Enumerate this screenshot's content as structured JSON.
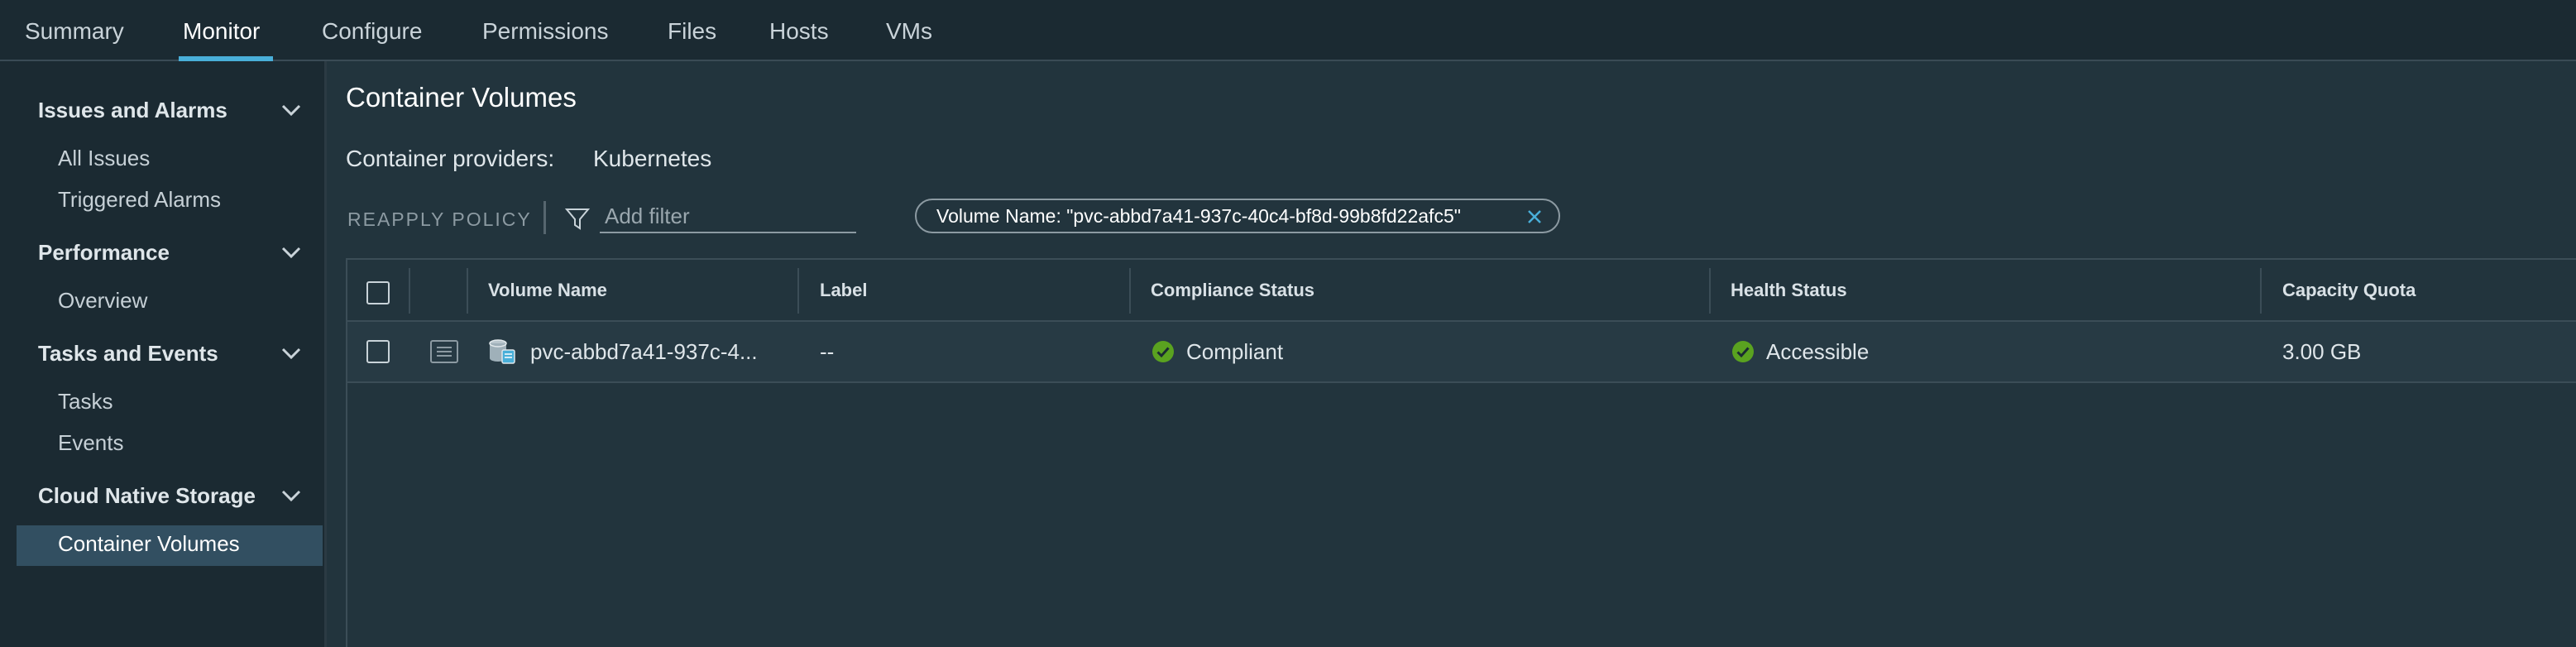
{
  "tabs": [
    {
      "label": "Summary"
    },
    {
      "label": "Monitor"
    },
    {
      "label": "Configure"
    },
    {
      "label": "Permissions"
    },
    {
      "label": "Files"
    },
    {
      "label": "Hosts"
    },
    {
      "label": "VMs"
    }
  ],
  "active_tab": "Monitor",
  "sidebar": {
    "groups": [
      {
        "label": "Issues and Alarms",
        "items": [
          "All Issues",
          "Triggered Alarms"
        ]
      },
      {
        "label": "Performance",
        "items": [
          "Overview"
        ]
      },
      {
        "label": "Tasks and Events",
        "items": [
          "Tasks",
          "Events"
        ]
      },
      {
        "label": "Cloud Native Storage",
        "items": [
          "Container Volumes"
        ]
      }
    ],
    "selected_item": "Container Volumes"
  },
  "main": {
    "title": "Container Volumes",
    "providers_label": "Container providers:",
    "providers_value": "Kubernetes",
    "reapply_policy": "REAPPLY POLICY",
    "filter_placeholder": "Add filter",
    "filter_chip": "Volume Name: \"pvc-abbd7a41-937c-40c4-bf8d-99b8fd22afc5\""
  },
  "grid": {
    "columns": [
      "Volume Name",
      "Label",
      "Compliance Status",
      "Health Status",
      "Capacity Quota"
    ],
    "rows": [
      {
        "volume_name": "pvc-abbd7a41-937c-4...",
        "label": "--",
        "compliance_status": "Compliant",
        "health_status": "Accessible",
        "capacity_quota": "3.00 GB"
      }
    ]
  },
  "colors": {
    "accent": "#49afd9",
    "success": "#5aa220",
    "background": "#1b2a32",
    "panel": "#22343d"
  }
}
